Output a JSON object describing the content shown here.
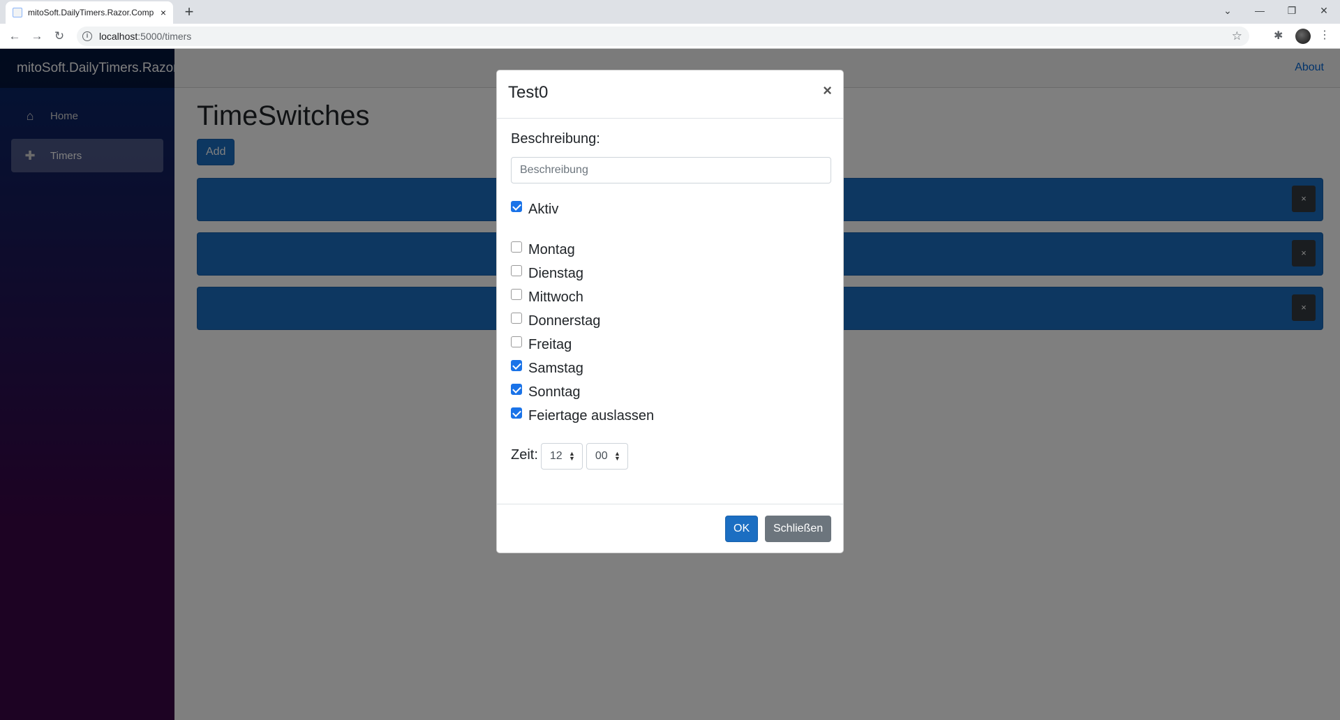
{
  "browser": {
    "tab_title": "mitoSoft.DailyTimers.Razor.Comp",
    "tab_close": "×",
    "new_tab": "+",
    "url_host": "localhost",
    "url_rest": ":5000/timers",
    "info": "i",
    "back": "←",
    "forward": "→",
    "reload": "↻",
    "star": "☆",
    "extensions": "✱",
    "menu": "⋮",
    "minimize": "—",
    "restore": "❐",
    "close": "✕",
    "tab_search": "⌄"
  },
  "app": {
    "brand": "mitoSoft.DailyTimers.Razor.Components",
    "about": "About",
    "nav": [
      {
        "label": "Home",
        "icon": "home-icon",
        "glyph": "⌂"
      },
      {
        "label": "Timers",
        "icon": "plus-icon",
        "glyph": "✚"
      }
    ],
    "page_title": "TimeSwitches",
    "add_label": "Add",
    "timer_delete": "×"
  },
  "modal": {
    "title": "Test0",
    "close": "×",
    "description_label": "Beschreibung:",
    "description_placeholder": "Beschreibung",
    "description_value": "",
    "active_label": "Aktiv",
    "active": true,
    "days": [
      {
        "label": "Montag",
        "checked": false
      },
      {
        "label": "Dienstag",
        "checked": false
      },
      {
        "label": "Mittwoch",
        "checked": false
      },
      {
        "label": "Donnerstag",
        "checked": false
      },
      {
        "label": "Freitag",
        "checked": false
      },
      {
        "label": "Samstag",
        "checked": true
      },
      {
        "label": "Sonntag",
        "checked": true
      },
      {
        "label": "Feiertage auslassen",
        "checked": true
      }
    ],
    "time_label": "Zeit:",
    "hour": "12",
    "minute": "00",
    "select_arrows": "▲▼",
    "ok_label": "OK",
    "close_label": "Schließen"
  },
  "colors": {
    "primary": "#1b6ec2",
    "secondary": "#6c757d",
    "checkbox": "#1a73e8"
  }
}
